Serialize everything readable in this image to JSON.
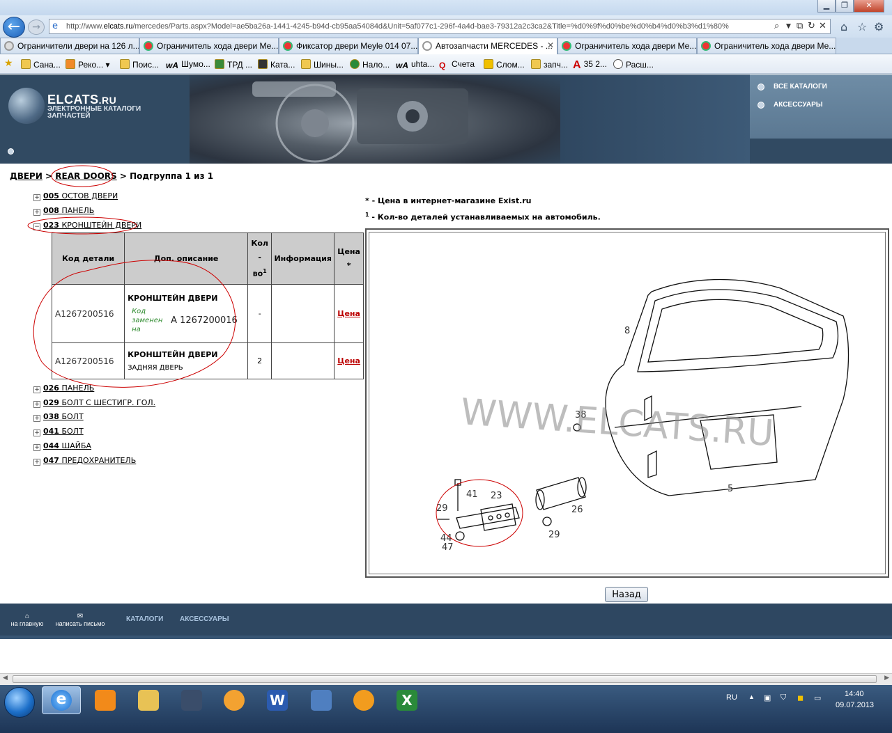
{
  "browser": {
    "url_prefix": "http://www.",
    "url_domain": "elcats.ru",
    "url_rest": "/mercedes/Parts.aspx?Model=ae5ba26a-1441-4245-b94d-cb95aa54084d&Unit=5af077c1-296f-4a4d-bae3-79312a2c3ca2&Title=%d0%9f%d0%be%d0%b4%d0%b3%d1%80%",
    "tabs": [
      {
        "label": "Ограничители двери на 126 л..."
      },
      {
        "label": "Ограничитель хода двери Ме..."
      },
      {
        "label": "Фиксатор двери Meyle 014 07..."
      },
      {
        "label": "Автозапчасти MERCEDES - ..."
      },
      {
        "label": "Ограничитель хода двери Ме..."
      },
      {
        "label": "Ограничитель хода двери Ме..."
      }
    ],
    "favorites": [
      "Сана...",
      "Реко...",
      "Поис...",
      "Шумо...",
      "ТРД ...",
      "Ката...",
      "Шины...",
      "Нало...",
      "uhta...",
      "Счета",
      "Слом...",
      "запч...",
      "35 2...",
      "Расш..."
    ]
  },
  "site": {
    "logo_title": "ELCATS",
    "logo_tld": ".RU",
    "logo_subtitle": "ЭЛЕКТРОННЫЕ КАТАЛОГИ ЗАПЧАСТЕЙ",
    "nav_all_catalogs": "ВСЕ КАТАЛОГИ",
    "nav_accessories": "АКСЕССУАРЫ"
  },
  "breadcrumb": {
    "root": "ДВЕРИ",
    "sep1": " > ",
    "current": "REAR DOORS",
    "sep2": " > ",
    "subgroup": "Подгруппа 1 из 1"
  },
  "tree": [
    {
      "num": "005",
      "label": " ОСТОВ ДВЕРИ",
      "toggle": "+"
    },
    {
      "num": "008",
      "label": " ПАНЕЛЬ",
      "toggle": "+"
    },
    {
      "num": "023",
      "label": " КРОНШТЕЙН ДВЕРИ",
      "toggle": "−"
    },
    {
      "num": "026",
      "label": " ПАНЕЛЬ",
      "toggle": "+"
    },
    {
      "num": "029",
      "label": " БОЛТ С ШЕСТИГР. ГОЛ.",
      "toggle": "+"
    },
    {
      "num": "038",
      "label": " БОЛТ",
      "toggle": "+"
    },
    {
      "num": "041",
      "label": " БОЛТ",
      "toggle": "+"
    },
    {
      "num": "044",
      "label": " ШАЙБА",
      "toggle": "+"
    },
    {
      "num": "047",
      "label": " ПРЕДОХРАНИТЕЛЬ",
      "toggle": "+"
    }
  ],
  "table": {
    "headers": {
      "code": "Код детали",
      "desc": "Доп. описание",
      "qty_a": "Кол",
      "qty_b": "-",
      "qty_c": "во",
      "qty_sup": "1",
      "info": "Информация",
      "price": "Цена",
      "price_star": "*"
    },
    "rows": [
      {
        "code": "A1267200516",
        "title": "КРОНШТЕЙН ДВЕРИ",
        "replaced_label": "Код заменен на",
        "replaced_code": "A  1267200016",
        "qty": "-",
        "info": "",
        "price": "Цена"
      },
      {
        "code": "A1267200516",
        "title": "КРОНШТЕЙН ДВЕРИ",
        "subtitle": "ЗАДНЯЯ ДВЕРЬ",
        "qty": "2",
        "info": "",
        "price": "Цена"
      }
    ]
  },
  "notes": {
    "price_star": "*",
    "price_text": " - Цена в интернет-магазине Exist.ru",
    "qty_sup": "1",
    "qty_text": " - Кол-во деталей устанавливаемых на автомобиль."
  },
  "diagram": {
    "watermark": "WWW.ELCATS.RU",
    "callouts": [
      "8",
      "38",
      "5",
      "41",
      "23",
      "29",
      "26",
      "29",
      "44",
      "47"
    ]
  },
  "back_button": "Назад",
  "footer": {
    "home": "на главную",
    "mail": "написать письмо",
    "catalogs": "КАТАЛОГИ",
    "accessories": "АКСЕССУАРЫ"
  },
  "taskbar": {
    "lang": "RU",
    "time": "14:40",
    "date": "09.07.2013"
  },
  "colors": {
    "header_bg": "#314a62",
    "price_link": "#bb0000",
    "annotation_red": "#cc0000"
  }
}
